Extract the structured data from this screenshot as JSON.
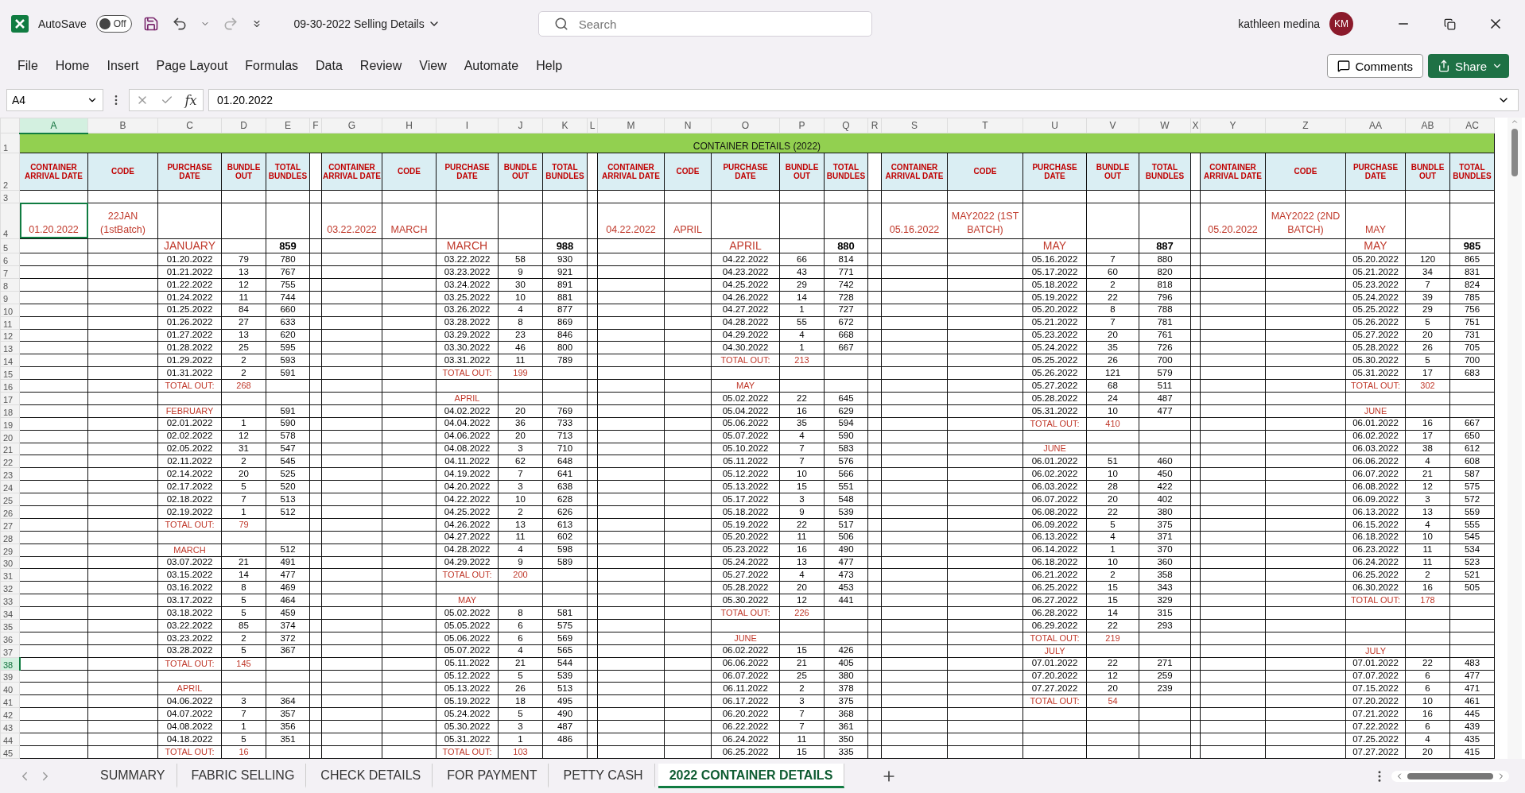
{
  "title_bar": {
    "autosave": {
      "label": "AutoSave",
      "state_text": "Off",
      "on": false
    },
    "document": "09-30-2022 Selling Details",
    "search": {
      "placeholder": "Search"
    },
    "user": "kathleen medina",
    "avatar": "KM"
  },
  "ribbon": {
    "tabs": [
      "File",
      "Home",
      "Insert",
      "Page Layout",
      "Formulas",
      "Data",
      "Review",
      "View",
      "Automate",
      "Help"
    ],
    "comments": "Comments",
    "share": "Share"
  },
  "formula_bar": {
    "name_box": "A4",
    "function_label": "fx",
    "value": "01.20.2022"
  },
  "sheet": {
    "title": "CONTAINER DETAILS (2022)",
    "columns": [
      {
        "label": "A",
        "selected": true
      },
      {
        "label": "B",
        "selected": false
      },
      {
        "label": "C",
        "selected": false
      },
      {
        "label": "D",
        "selected": false
      },
      {
        "label": "E",
        "selected": false
      },
      {
        "label": "F",
        "selected": false
      },
      {
        "label": "G",
        "selected": false
      },
      {
        "label": "H",
        "selected": false
      },
      {
        "label": "I",
        "selected": false
      },
      {
        "label": "J",
        "selected": false
      },
      {
        "label": "K",
        "selected": false
      },
      {
        "label": "L",
        "selected": false
      },
      {
        "label": "M",
        "selected": false
      },
      {
        "label": "N",
        "selected": false
      },
      {
        "label": "O",
        "selected": false
      },
      {
        "label": "P",
        "selected": false
      },
      {
        "label": "Q",
        "selected": false
      },
      {
        "label": "R",
        "selected": false
      },
      {
        "label": "S",
        "selected": false
      },
      {
        "label": "T",
        "selected": false
      },
      {
        "label": "U",
        "selected": false
      },
      {
        "label": "V",
        "selected": false
      },
      {
        "label": "W",
        "selected": false
      },
      {
        "label": "X",
        "selected": false
      },
      {
        "label": "Y",
        "selected": false
      },
      {
        "label": "Z",
        "selected": false
      },
      {
        "label": "AA",
        "selected": false
      },
      {
        "label": "AB",
        "selected": false
      },
      {
        "label": "AC",
        "selected": false
      }
    ],
    "rows": [
      {
        "label": "1",
        "selected": false
      },
      {
        "label": "2",
        "selected": false
      },
      {
        "label": "3",
        "selected": false
      },
      {
        "label": "4",
        "selected": false
      },
      {
        "label": "5",
        "selected": false
      },
      {
        "label": "6",
        "selected": false
      },
      {
        "label": "7",
        "selected": false
      },
      {
        "label": "8",
        "selected": false
      },
      {
        "label": "9",
        "selected": false
      },
      {
        "label": "10",
        "selected": false
      },
      {
        "label": "11",
        "selected": false
      },
      {
        "label": "12",
        "selected": false
      },
      {
        "label": "13",
        "selected": false
      },
      {
        "label": "14",
        "selected": false
      },
      {
        "label": "15",
        "selected": false
      },
      {
        "label": "16",
        "selected": false
      },
      {
        "label": "17",
        "selected": false
      },
      {
        "label": "18",
        "selected": false
      },
      {
        "label": "19",
        "selected": false
      },
      {
        "label": "20",
        "selected": false
      },
      {
        "label": "21",
        "selected": false
      },
      {
        "label": "22",
        "selected": false
      },
      {
        "label": "23",
        "selected": false
      },
      {
        "label": "24",
        "selected": false
      },
      {
        "label": "25",
        "selected": false
      },
      {
        "label": "26",
        "selected": false
      },
      {
        "label": "27",
        "selected": false
      },
      {
        "label": "28",
        "selected": false
      },
      {
        "label": "29",
        "selected": false
      },
      {
        "label": "30",
        "selected": false
      },
      {
        "label": "31",
        "selected": false
      },
      {
        "label": "32",
        "selected": false
      },
      {
        "label": "33",
        "selected": false
      },
      {
        "label": "34",
        "selected": false
      },
      {
        "label": "35",
        "selected": false
      },
      {
        "label": "36",
        "selected": false
      },
      {
        "label": "37",
        "selected": false
      },
      {
        "label": "38",
        "selected": true
      },
      {
        "label": "39",
        "selected": false
      },
      {
        "label": "40",
        "selected": false
      },
      {
        "label": "41",
        "selected": false
      },
      {
        "label": "42",
        "selected": false
      },
      {
        "label": "43",
        "selected": false
      },
      {
        "label": "44",
        "selected": false
      },
      {
        "label": "45",
        "selected": false
      }
    ],
    "blocks": [
      {
        "headers": [
          "CONTAINER ARRIVAL DATE",
          "CODE",
          "PURCHASE DATE",
          "BUNDLE OUT",
          "TOTAL BUNDLES"
        ],
        "arrival": {
          "text": "01.20.2022",
          "selected": true
        },
        "code": "22JAN (1stBatch)",
        "entries": [
          {
            "kind": "month",
            "label": "JANUARY",
            "total": "859"
          },
          {
            "kind": "entry",
            "date": "01.20.2022",
            "out": "79",
            "total": "780"
          },
          {
            "kind": "entry",
            "date": "01.21.2022",
            "out": "13",
            "total": "767"
          },
          {
            "kind": "entry",
            "date": "01.22.2022",
            "out": "12",
            "total": "755"
          },
          {
            "kind": "entry",
            "date": "01.24.2022",
            "out": "11",
            "total": "744"
          },
          {
            "kind": "entry",
            "date": "01.25.2022",
            "out": "84",
            "total": "660"
          },
          {
            "kind": "entry",
            "date": "01.26.2022",
            "out": "27",
            "total": "633"
          },
          {
            "kind": "entry",
            "date": "01.27.2022",
            "out": "13",
            "total": "620"
          },
          {
            "kind": "entry",
            "date": "01.28.2022",
            "out": "25",
            "total": "595"
          },
          {
            "kind": "entry",
            "date": "01.29.2022",
            "out": "2",
            "total": "593"
          },
          {
            "kind": "entry",
            "date": "01.31.2022",
            "out": "2",
            "total": "591"
          },
          {
            "kind": "sum",
            "label": "TOTAL OUT:",
            "out": "268"
          },
          {
            "kind": "blank"
          },
          {
            "kind": "label",
            "label": "FEBRUARY",
            "total": "591"
          },
          {
            "kind": "entry",
            "date": "02.01.2022",
            "out": "1",
            "total": "590"
          },
          {
            "kind": "entry",
            "date": "02.02.2022",
            "out": "12",
            "total": "578"
          },
          {
            "kind": "entry",
            "date": "02.05.2022",
            "out": "31",
            "total": "547"
          },
          {
            "kind": "entry",
            "date": "02.11.2022",
            "out": "2",
            "total": "545"
          },
          {
            "kind": "entry",
            "date": "02.14.2022",
            "out": "20",
            "total": "525"
          },
          {
            "kind": "entry",
            "date": "02.17.2022",
            "out": "5",
            "total": "520"
          },
          {
            "kind": "entry",
            "date": "02.18.2022",
            "out": "7",
            "total": "513"
          },
          {
            "kind": "entry",
            "date": "02.19.2022",
            "out": "1",
            "total": "512"
          },
          {
            "kind": "sum",
            "label": "TOTAL OUT:",
            "out": "79"
          },
          {
            "kind": "blank"
          },
          {
            "kind": "label",
            "label": "MARCH",
            "total": "512"
          },
          {
            "kind": "entry",
            "date": "03.07.2022",
            "out": "21",
            "total": "491"
          },
          {
            "kind": "entry",
            "date": "03.15.2022",
            "out": "14",
            "total": "477"
          },
          {
            "kind": "entry",
            "date": "03.16.2022",
            "out": "8",
            "total": "469"
          },
          {
            "kind": "entry",
            "date": "03.17.2022",
            "out": "5",
            "total": "464"
          },
          {
            "kind": "entry",
            "date": "03.18.2022",
            "out": "5",
            "total": "459"
          },
          {
            "kind": "entry",
            "date": "03.22.2022",
            "out": "85",
            "total": "374"
          },
          {
            "kind": "entry",
            "date": "03.23.2022",
            "out": "2",
            "total": "372"
          },
          {
            "kind": "entry",
            "date": "03.28.2022",
            "out": "5",
            "total": "367"
          },
          {
            "kind": "sum",
            "label": "TOTAL OUT:",
            "out": "145"
          },
          {
            "kind": "blank"
          },
          {
            "kind": "label",
            "label": "APRIL"
          },
          {
            "kind": "entry",
            "date": "04.06.2022",
            "out": "3",
            "total": "364"
          },
          {
            "kind": "entry",
            "date": "04.07.2022",
            "out": "7",
            "total": "357"
          },
          {
            "kind": "entry",
            "date": "04.08.2022",
            "out": "1",
            "total": "356"
          },
          {
            "kind": "entry",
            "date": "04.18.2022",
            "out": "5",
            "total": "351"
          },
          {
            "kind": "sum",
            "label": "TOTAL OUT:",
            "out": "16"
          }
        ]
      },
      {
        "headers": [
          "CONTAINER ARRIVAL DATE",
          "CODE",
          "PURCHASE DATE",
          "BUNDLE OUT",
          "TOTAL BUNDLES"
        ],
        "arrival": {
          "text": "03.22.2022",
          "selected": false
        },
        "code": "MARCH",
        "entries": [
          {
            "kind": "month",
            "label": "MARCH",
            "total": "988"
          },
          {
            "kind": "entry",
            "date": "03.22.2022",
            "out": "58",
            "total": "930"
          },
          {
            "kind": "entry",
            "date": "03.23.2022",
            "out": "9",
            "total": "921"
          },
          {
            "kind": "entry",
            "date": "03.24.2022",
            "out": "30",
            "total": "891"
          },
          {
            "kind": "entry",
            "date": "03.25.2022",
            "out": "10",
            "total": "881"
          },
          {
            "kind": "entry",
            "date": "03.26.2022",
            "out": "4",
            "total": "877"
          },
          {
            "kind": "entry",
            "date": "03.28.2022",
            "out": "8",
            "total": "869"
          },
          {
            "kind": "entry",
            "date": "03.29.2022",
            "out": "23",
            "total": "846"
          },
          {
            "kind": "entry",
            "date": "03.30.2022",
            "out": "46",
            "total": "800"
          },
          {
            "kind": "entry",
            "date": "03.31.2022",
            "out": "11",
            "total": "789"
          },
          {
            "kind": "sum",
            "label": "TOTAL OUT:",
            "out": "199"
          },
          {
            "kind": "blank"
          },
          {
            "kind": "label",
            "label": "APRIL"
          },
          {
            "kind": "entry",
            "date": "04.02.2022",
            "out": "20",
            "total": "769"
          },
          {
            "kind": "entry",
            "date": "04.04.2022",
            "out": "36",
            "total": "733"
          },
          {
            "kind": "entry",
            "date": "04.06.2022",
            "out": "20",
            "total": "713"
          },
          {
            "kind": "entry",
            "date": "04.08.2022",
            "out": "3",
            "total": "710"
          },
          {
            "kind": "entry",
            "date": "04.11.2022",
            "out": "62",
            "total": "648"
          },
          {
            "kind": "entry",
            "date": "04.19.2022",
            "out": "7",
            "total": "641"
          },
          {
            "kind": "entry",
            "date": "04.20.2022",
            "out": "3",
            "total": "638"
          },
          {
            "kind": "entry",
            "date": "04.22.2022",
            "out": "10",
            "total": "628"
          },
          {
            "kind": "entry",
            "date": "04.25.2022",
            "out": "2",
            "total": "626"
          },
          {
            "kind": "entry",
            "date": "04.26.2022",
            "out": "13",
            "total": "613"
          },
          {
            "kind": "entry",
            "date": "04.27.2022",
            "out": "11",
            "total": "602"
          },
          {
            "kind": "entry",
            "date": "04.28.2022",
            "out": "4",
            "total": "598"
          },
          {
            "kind": "entry",
            "date": "04.29.2022",
            "out": "9",
            "total": "589"
          },
          {
            "kind": "sum",
            "label": "TOTAL OUT:",
            "out": "200"
          },
          {
            "kind": "blank"
          },
          {
            "kind": "label",
            "label": "MAY"
          },
          {
            "kind": "entry",
            "date": "05.02.2022",
            "out": "8",
            "total": "581"
          },
          {
            "kind": "entry",
            "date": "05.05.2022",
            "out": "6",
            "total": "575"
          },
          {
            "kind": "entry",
            "date": "05.06.2022",
            "out": "6",
            "total": "569"
          },
          {
            "kind": "entry",
            "date": "05.07.2022",
            "out": "4",
            "total": "565"
          },
          {
            "kind": "entry",
            "date": "05.11.2022",
            "out": "21",
            "total": "544"
          },
          {
            "kind": "entry",
            "date": "05.12.2022",
            "out": "5",
            "total": "539"
          },
          {
            "kind": "entry",
            "date": "05.13.2022",
            "out": "26",
            "total": "513"
          },
          {
            "kind": "entry",
            "date": "05.19.2022",
            "out": "18",
            "total": "495"
          },
          {
            "kind": "entry",
            "date": "05.24.2022",
            "out": "5",
            "total": "490"
          },
          {
            "kind": "entry",
            "date": "05.30.2022",
            "out": "3",
            "total": "487"
          },
          {
            "kind": "entry",
            "date": "05.31.2022",
            "out": "1",
            "total": "486"
          },
          {
            "kind": "sum",
            "label": "TOTAL OUT:",
            "out": "103"
          }
        ]
      },
      {
        "headers": [
          "CONTAINER ARRIVAL DATE",
          "CODE",
          "PURCHASE DATE",
          "BUNDLE OUT",
          "TOTAL BUNDLES"
        ],
        "arrival": {
          "text": "04.22.2022",
          "selected": false
        },
        "code": "APRIL",
        "entries": [
          {
            "kind": "month",
            "label": "APRIL",
            "total": "880"
          },
          {
            "kind": "entry",
            "date": "04.22.2022",
            "out": "66",
            "total": "814"
          },
          {
            "kind": "entry",
            "date": "04.23.2022",
            "out": "43",
            "total": "771"
          },
          {
            "kind": "entry",
            "date": "04.25.2022",
            "out": "29",
            "total": "742"
          },
          {
            "kind": "entry",
            "date": "04.26.2022",
            "out": "14",
            "total": "728"
          },
          {
            "kind": "entry",
            "date": "04.27.2022",
            "out": "1",
            "total": "727"
          },
          {
            "kind": "entry",
            "date": "04.28.2022",
            "out": "55",
            "total": "672"
          },
          {
            "kind": "entry",
            "date": "04.29.2022",
            "out": "4",
            "total": "668"
          },
          {
            "kind": "entry",
            "date": "04.30.2022",
            "out": "1",
            "total": "667"
          },
          {
            "kind": "sum",
            "label": "TOTAL OUT:",
            "out": "213"
          },
          {
            "kind": "blank"
          },
          {
            "kind": "label",
            "label": "MAY"
          },
          {
            "kind": "entry",
            "date": "05.02.2022",
            "out": "22",
            "total": "645"
          },
          {
            "kind": "entry",
            "date": "05.04.2022",
            "out": "16",
            "total": "629"
          },
          {
            "kind": "entry",
            "date": "05.06.2022",
            "out": "35",
            "total": "594"
          },
          {
            "kind": "entry",
            "date": "05.07.2022",
            "out": "4",
            "total": "590"
          },
          {
            "kind": "entry",
            "date": "05.10.2022",
            "out": "7",
            "total": "583"
          },
          {
            "kind": "entry",
            "date": "05.11.2022",
            "out": "7",
            "total": "576"
          },
          {
            "kind": "entry",
            "date": "05.12.2022",
            "out": "10",
            "total": "566"
          },
          {
            "kind": "entry",
            "date": "05.13.2022",
            "out": "15",
            "total": "551"
          },
          {
            "kind": "entry",
            "date": "05.17.2022",
            "out": "3",
            "total": "548"
          },
          {
            "kind": "entry",
            "date": "05.18.2022",
            "out": "9",
            "total": "539"
          },
          {
            "kind": "entry",
            "date": "05.19.2022",
            "out": "22",
            "total": "517"
          },
          {
            "kind": "entry",
            "date": "05.20.2022",
            "out": "11",
            "total": "506"
          },
          {
            "kind": "entry",
            "date": "05.23.2022",
            "out": "16",
            "total": "490"
          },
          {
            "kind": "entry",
            "date": "05.24.2022",
            "out": "13",
            "total": "477"
          },
          {
            "kind": "entry",
            "date": "05.27.2022",
            "out": "4",
            "total": "473"
          },
          {
            "kind": "entry",
            "date": "05.28.2022",
            "out": "20",
            "total": "453"
          },
          {
            "kind": "entry",
            "date": "05.30.2022",
            "out": "12",
            "total": "441"
          },
          {
            "kind": "sum",
            "label": "TOTAL OUT:",
            "out": "226"
          },
          {
            "kind": "blank"
          },
          {
            "kind": "label",
            "label": "JUNE"
          },
          {
            "kind": "entry",
            "date": "06.02.2022",
            "out": "15",
            "total": "426"
          },
          {
            "kind": "entry",
            "date": "06.06.2022",
            "out": "21",
            "total": "405"
          },
          {
            "kind": "entry",
            "date": "06.07.2022",
            "out": "25",
            "total": "380"
          },
          {
            "kind": "entry",
            "date": "06.11.2022",
            "out": "2",
            "total": "378"
          },
          {
            "kind": "entry",
            "date": "06.17.2022",
            "out": "3",
            "total": "375"
          },
          {
            "kind": "entry",
            "date": "06.20.2022",
            "out": "7",
            "total": "368"
          },
          {
            "kind": "entry",
            "date": "06.22.2022",
            "out": "7",
            "total": "361"
          },
          {
            "kind": "entry",
            "date": "06.24.2022",
            "out": "11",
            "total": "350"
          },
          {
            "kind": "entry",
            "date": "06.25.2022",
            "out": "15",
            "total": "335"
          }
        ]
      },
      {
        "headers": [
          "CONTAINER ARRIVAL DATE",
          "CODE",
          "PURCHASE DATE",
          "BUNDLE OUT",
          "TOTAL BUNDLES"
        ],
        "arrival": {
          "text": "05.16.2022",
          "selected": false
        },
        "code": "MAY2022 (1ST BATCH)",
        "entries": [
          {
            "kind": "month",
            "label": "MAY",
            "total": "887"
          },
          {
            "kind": "entry",
            "date": "05.16.2022",
            "out": "7",
            "total": "880"
          },
          {
            "kind": "entry",
            "date": "05.17.2022",
            "out": "60",
            "total": "820"
          },
          {
            "kind": "entry",
            "date": "05.18.2022",
            "out": "2",
            "total": "818"
          },
          {
            "kind": "entry",
            "date": "05.19.2022",
            "out": "22",
            "total": "796"
          },
          {
            "kind": "entry",
            "date": "05.20.2022",
            "out": "8",
            "total": "788"
          },
          {
            "kind": "entry",
            "date": "05.21.2022",
            "out": "7",
            "total": "781"
          },
          {
            "kind": "entry",
            "date": "05.23.2022",
            "out": "20",
            "total": "761"
          },
          {
            "kind": "entry",
            "date": "05.24.2022",
            "out": "35",
            "total": "726"
          },
          {
            "kind": "entry",
            "date": "05.25.2022",
            "out": "26",
            "total": "700"
          },
          {
            "kind": "entry",
            "date": "05.26.2022",
            "out": "121",
            "total": "579"
          },
          {
            "kind": "entry",
            "date": "05.27.2022",
            "out": "68",
            "total": "511"
          },
          {
            "kind": "entry",
            "date": "05.28.2022",
            "out": "24",
            "total": "487"
          },
          {
            "kind": "entry",
            "date": "05.31.2022",
            "out": "10",
            "total": "477"
          },
          {
            "kind": "sum",
            "label": "TOTAL OUT:",
            "out": "410"
          },
          {
            "kind": "blank"
          },
          {
            "kind": "label",
            "label": "JUNE"
          },
          {
            "kind": "entry",
            "date": "06.01.2022",
            "out": "51",
            "total": "460"
          },
          {
            "kind": "entry",
            "date": "06.02.2022",
            "out": "10",
            "total": "450"
          },
          {
            "kind": "entry",
            "date": "06.03.2022",
            "out": "28",
            "total": "422"
          },
          {
            "kind": "entry",
            "date": "06.07.2022",
            "out": "20",
            "total": "402"
          },
          {
            "kind": "entry",
            "date": "06.08.2022",
            "out": "22",
            "total": "380"
          },
          {
            "kind": "entry",
            "date": "06.09.2022",
            "out": "5",
            "total": "375"
          },
          {
            "kind": "entry",
            "date": "06.13.2022",
            "out": "4",
            "total": "371"
          },
          {
            "kind": "entry",
            "date": "06.14.2022",
            "out": "1",
            "total": "370"
          },
          {
            "kind": "entry",
            "date": "06.18.2022",
            "out": "10",
            "total": "360"
          },
          {
            "kind": "entry",
            "date": "06.21.2022",
            "out": "2",
            "total": "358"
          },
          {
            "kind": "entry",
            "date": "06.25.2022",
            "out": "15",
            "total": "343"
          },
          {
            "kind": "entry",
            "date": "06.27.2022",
            "out": "15",
            "total": "329"
          },
          {
            "kind": "entry",
            "date": "06.28.2022",
            "out": "14",
            "total": "315"
          },
          {
            "kind": "entry",
            "date": "06.29.2022",
            "out": "22",
            "total": "293"
          },
          {
            "kind": "sum",
            "label": "TOTAL OUT:",
            "out": "219"
          },
          {
            "kind": "label",
            "label": "JULY"
          },
          {
            "kind": "entry",
            "date": "07.01.2022",
            "out": "22",
            "total": "271"
          },
          {
            "kind": "entry",
            "date": "07.20.2022",
            "out": "12",
            "total": "259"
          },
          {
            "kind": "entry",
            "date": "07.27.2022",
            "out": "20",
            "total": "239"
          },
          {
            "kind": "sum",
            "label": "TOTAL OUT:",
            "out": "54"
          },
          {
            "kind": "blank"
          },
          {
            "kind": "blank"
          },
          {
            "kind": "blank"
          },
          {
            "kind": "blank"
          }
        ]
      },
      {
        "headers": [
          "CONTAINER ARRIVAL DATE",
          "CODE",
          "PURCHASE DATE",
          "BUNDLE OUT",
          "TOTAL BUNDLES"
        ],
        "arrival": {
          "text": "05.20.2022",
          "selected": false
        },
        "code": "MAY2022 (2ND BATCH)",
        "note": "MAY",
        "entries": [
          {
            "kind": "month",
            "label": "MAY",
            "total": "985"
          },
          {
            "kind": "entry",
            "date": "05.20.2022",
            "out": "120",
            "total": "865"
          },
          {
            "kind": "entry",
            "date": "05.21.2022",
            "out": "34",
            "total": "831"
          },
          {
            "kind": "entry",
            "date": "05.23.2022",
            "out": "7",
            "total": "824"
          },
          {
            "kind": "entry",
            "date": "05.24.2022",
            "out": "39",
            "total": "785"
          },
          {
            "kind": "entry",
            "date": "05.25.2022",
            "out": "29",
            "total": "756"
          },
          {
            "kind": "entry",
            "date": "05.26.2022",
            "out": "5",
            "total": "751"
          },
          {
            "kind": "entry",
            "date": "05.27.2022",
            "out": "20",
            "total": "731"
          },
          {
            "kind": "entry",
            "date": "05.28.2022",
            "out": "26",
            "total": "705"
          },
          {
            "kind": "entry",
            "date": "05.30.2022",
            "out": "5",
            "total": "700"
          },
          {
            "kind": "entry",
            "date": "05.31.2022",
            "out": "17",
            "total": "683"
          },
          {
            "kind": "sum",
            "label": "TOTAL OUT:",
            "out": "302"
          },
          {
            "kind": "blank"
          },
          {
            "kind": "label",
            "label": "JUNE"
          },
          {
            "kind": "entry",
            "date": "06.01.2022",
            "out": "16",
            "total": "667"
          },
          {
            "kind": "entry",
            "date": "06.02.2022",
            "out": "17",
            "total": "650"
          },
          {
            "kind": "entry",
            "date": "06.03.2022",
            "out": "38",
            "total": "612"
          },
          {
            "kind": "entry",
            "date": "06.06.2022",
            "out": "4",
            "total": "608"
          },
          {
            "kind": "entry",
            "date": "06.07.2022",
            "out": "21",
            "total": "587"
          },
          {
            "kind": "entry",
            "date": "06.08.2022",
            "out": "12",
            "total": "575"
          },
          {
            "kind": "entry",
            "date": "06.09.2022",
            "out": "3",
            "total": "572"
          },
          {
            "kind": "entry",
            "date": "06.13.2022",
            "out": "13",
            "total": "559"
          },
          {
            "kind": "entry",
            "date": "06.15.2022",
            "out": "4",
            "total": "555"
          },
          {
            "kind": "entry",
            "date": "06.18.2022",
            "out": "10",
            "total": "545"
          },
          {
            "kind": "entry",
            "date": "06.23.2022",
            "out": "11",
            "total": "534"
          },
          {
            "kind": "entry",
            "date": "06.24.2022",
            "out": "11",
            "total": "523"
          },
          {
            "kind": "entry",
            "date": "06.25.2022",
            "out": "2",
            "total": "521"
          },
          {
            "kind": "entry",
            "date": "06.30.2022",
            "out": "16",
            "total": "505"
          },
          {
            "kind": "sum",
            "label": "TOTAL OUT:",
            "out": "178"
          },
          {
            "kind": "blank"
          },
          {
            "kind": "blank"
          },
          {
            "kind": "blank"
          },
          {
            "kind": "label",
            "label": "JULY"
          },
          {
            "kind": "entry",
            "date": "07.01.2022",
            "out": "22",
            "total": "483"
          },
          {
            "kind": "entry",
            "date": "07.07.2022",
            "out": "6",
            "total": "477"
          },
          {
            "kind": "entry",
            "date": "07.15.2022",
            "out": "6",
            "total": "471"
          },
          {
            "kind": "entry",
            "date": "07.20.2022",
            "out": "10",
            "total": "461"
          },
          {
            "kind": "entry",
            "date": "07.21.2022",
            "out": "16",
            "total": "445"
          },
          {
            "kind": "entry",
            "date": "07.22.2022",
            "out": "6",
            "total": "439"
          },
          {
            "kind": "entry",
            "date": "07.25.2022",
            "out": "4",
            "total": "435"
          },
          {
            "kind": "entry",
            "date": "07.27.2022",
            "out": "20",
            "total": "415"
          }
        ]
      }
    ]
  },
  "sheet_tabs": [
    {
      "label": "SUMMARY",
      "selected": false
    },
    {
      "label": "FABRIC SELLING",
      "selected": false
    },
    {
      "label": "CHECK DETAILS",
      "selected": false
    },
    {
      "label": "FOR PAYMENT",
      "selected": false
    },
    {
      "label": "PETTY CASH",
      "selected": false
    },
    {
      "label": "2022 CONTAINER DETAILS",
      "selected": true
    }
  ]
}
